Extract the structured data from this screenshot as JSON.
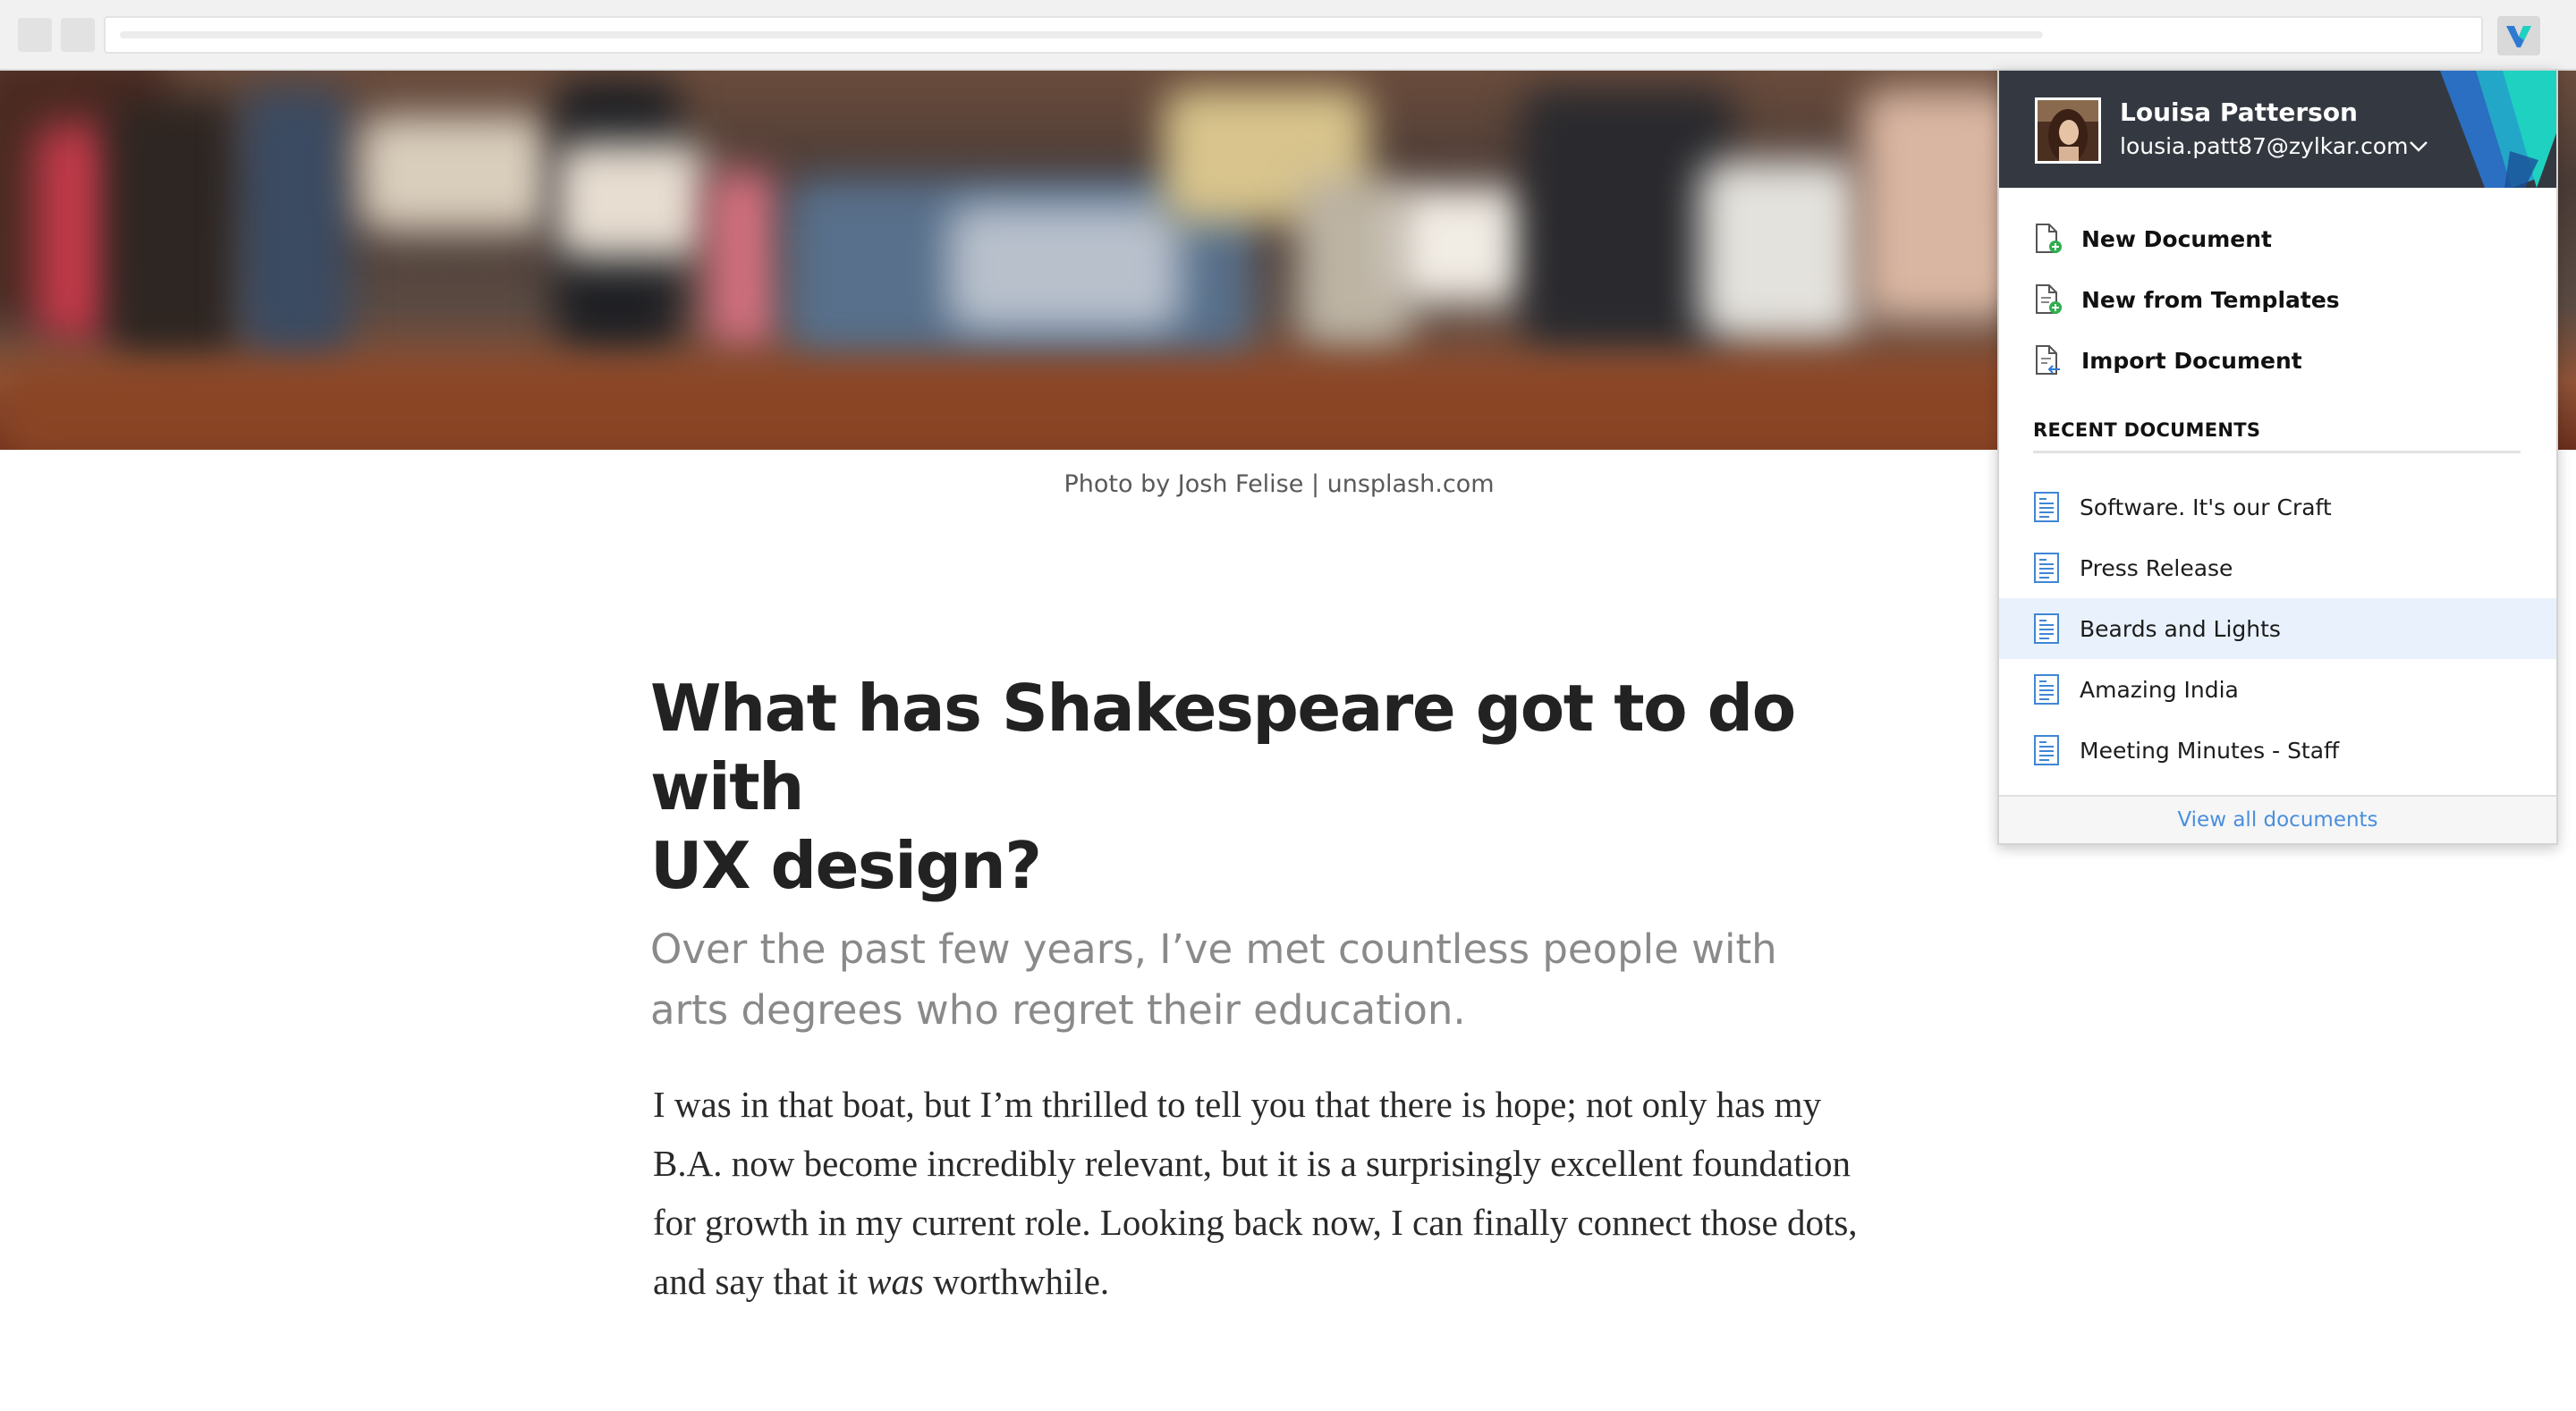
{
  "colors": {
    "header_bg": "#343941",
    "accent_blue": "#2e7ad1",
    "accent_teal": "#1fd1c0",
    "link": "#4a8fdc",
    "active_row": "#e9f2fc"
  },
  "hero": {
    "caption": "Photo by Josh Felise | unsplash.com"
  },
  "article": {
    "title": "What has Shakespeare got to do with\nUX design?",
    "subtitle": "Over the past few years, I’ve met countless people with arts degrees who regret their education.",
    "body_before": "I was in that boat, but I’m thrilled to tell you that there is hope; not only has my B.A. now become incredibly relevant, but it is a surprisingly excellent foundation for growth in my current role. Looking back now, I can finally connect those dots, and say that it ",
    "body_emphasis": "was",
    "body_after": " worthwhile."
  },
  "panel": {
    "user": {
      "name": "Louisa Patterson",
      "email": "lousia.patt87@zylkar.com"
    },
    "actions": [
      {
        "label": "New Document",
        "icon": "new-document-icon"
      },
      {
        "label": "New from Templates",
        "icon": "new-template-icon"
      },
      {
        "label": "Import Document",
        "icon": "import-document-icon"
      }
    ],
    "recent_title": "RECENT DOCUMENTS",
    "recent": [
      {
        "label": "Software. It's our Craft",
        "active": false
      },
      {
        "label": "Press Release",
        "active": false
      },
      {
        "label": "Beards and Lights",
        "active": true
      },
      {
        "label": "Amazing India",
        "active": false
      },
      {
        "label": "Meeting Minutes - Staff",
        "active": false
      }
    ],
    "footer_link": "View all documents"
  }
}
